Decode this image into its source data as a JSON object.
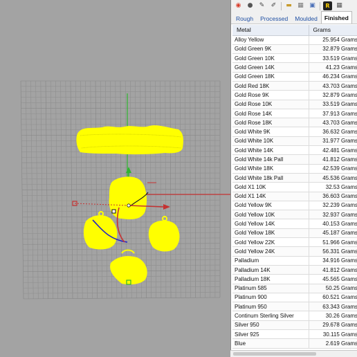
{
  "toolbar": {
    "icons": [
      "color-wheel-icon",
      "sphere-icon",
      "brush-icon",
      "pencil-icon",
      "folder-icon",
      "layers-icon",
      "window-icon",
      "render-icon",
      "grid-icon"
    ]
  },
  "tabs": [
    {
      "label": "Rough",
      "active": false
    },
    {
      "label": "Processed",
      "active": false
    },
    {
      "label": "Moulded",
      "active": false
    },
    {
      "label": "Finished",
      "active": true
    }
  ],
  "table": {
    "headers": {
      "metal": "Metal",
      "grams": "Grams"
    },
    "rows": [
      {
        "metal": "Alloy Yellow",
        "grams": "25.954 Grams"
      },
      {
        "metal": "Gold Green 9K",
        "grams": "32.879 Grams"
      },
      {
        "metal": "Gold Green 10K",
        "grams": "33.519 Grams"
      },
      {
        "metal": "Gold Green 14K",
        "grams": "41.23 Grams"
      },
      {
        "metal": "Gold Green 18K",
        "grams": "46.234 Grams"
      },
      {
        "metal": "Gold Red 18K",
        "grams": "43.703 Grams"
      },
      {
        "metal": "Gold Rose 9K",
        "grams": "32.879 Grams"
      },
      {
        "metal": "Gold Rose 10K",
        "grams": "33.519 Grams"
      },
      {
        "metal": "Gold Rose 14K",
        "grams": "37.913 Grams"
      },
      {
        "metal": "Gold Rose 18K",
        "grams": "43.703 Grams"
      },
      {
        "metal": "Gold White 9K",
        "grams": "36.632 Grams"
      },
      {
        "metal": "Gold White 10K",
        "grams": "31.977 Grams"
      },
      {
        "metal": "Gold White 14K",
        "grams": "42.481 Grams"
      },
      {
        "metal": "Gold White 14k Pall",
        "grams": "41.812 Grams"
      },
      {
        "metal": "Gold White 18K",
        "grams": "42.539 Grams"
      },
      {
        "metal": "Gold White 18k Pall",
        "grams": "45.536 Grams"
      },
      {
        "metal": "Gold X1 10K",
        "grams": "32.53 Grams"
      },
      {
        "metal": "Gold X1 14K",
        "grams": "36.603 Grams"
      },
      {
        "metal": "Gold Yellow 9K",
        "grams": "32.239 Grams"
      },
      {
        "metal": "Gold Yellow 10K",
        "grams": "32.937 Grams"
      },
      {
        "metal": "Gold Yellow 14K",
        "grams": "40.153 Grams"
      },
      {
        "metal": "Gold Yellow 18K",
        "grams": "45.187 Grams"
      },
      {
        "metal": "Gold Yellow 22K",
        "grams": "51.966 Grams"
      },
      {
        "metal": "Gold Yellow 24K",
        "grams": "56.331 Grams"
      },
      {
        "metal": "Palladium",
        "grams": "34.916 Grams"
      },
      {
        "metal": "Palladium 14K",
        "grams": "41.812 Grams"
      },
      {
        "metal": "Palladium 18K",
        "grams": "45.565 Grams"
      },
      {
        "metal": "Platinum 585",
        "grams": "50.25 Grams"
      },
      {
        "metal": "Platinum 900",
        "grams": "60.521 Grams"
      },
      {
        "metal": "Platinum 950",
        "grams": "63.343 Grams"
      },
      {
        "metal": "Continum Sterling Silver",
        "grams": "30.26 Grams"
      },
      {
        "metal": "Silver 950",
        "grams": "29.678 Grams"
      },
      {
        "metal": "Silver 925",
        "grams": "30.115 Grams"
      },
      {
        "metal": "Blue",
        "grams": "2.619 Grams"
      }
    ]
  },
  "colors": {
    "viewport_bg": "#a3a3a3",
    "grid_line": "#8f8f8f",
    "object_selected": "#ffff00",
    "axis_x": "#d43030",
    "axis_y": "#2fb52f",
    "gumball_blue": "#2020c8",
    "tab_link": "#1f4fa3"
  }
}
